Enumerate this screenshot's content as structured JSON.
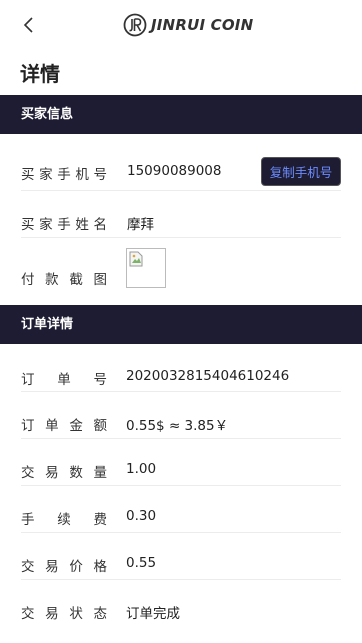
{
  "header": {
    "back_icon": "chevron-left-icon",
    "logo_text": "JINRUI COIN",
    "logo_icon": "jr-logo-icon"
  },
  "page_title": "详情",
  "buyer_section": {
    "title": "买家信息",
    "phone_label": [
      "买",
      "家",
      "手",
      "机",
      "号"
    ],
    "phone_value": "15090089008",
    "copy_button": "复制手机号",
    "name_label": [
      "买",
      "家",
      "手",
      "姓",
      "名"
    ],
    "name_value": "摩拜",
    "screenshot_label": [
      "付",
      "款",
      "截",
      "图"
    ],
    "screenshot_icon": "broken-image-icon"
  },
  "order_section": {
    "title": "订单详情",
    "rows": [
      {
        "label": [
          "订",
          "单",
          "号"
        ],
        "value": "2020032815404610246"
      },
      {
        "label": [
          "订",
          "单",
          "金",
          "额"
        ],
        "value": "0.55$ ≈ 3.85￥"
      },
      {
        "label": [
          "交",
          "易",
          "数",
          "量"
        ],
        "value": "1.00"
      },
      {
        "label": [
          "手",
          "续",
          "费"
        ],
        "value": "0.30"
      },
      {
        "label": [
          "交",
          "易",
          "价",
          "格"
        ],
        "value": "0.55"
      },
      {
        "label": [
          "交",
          "易",
          "状",
          "态"
        ],
        "value": "订单完成"
      }
    ]
  },
  "colors": {
    "section_bg": "#1e1c33",
    "button_text": "#6d8dff"
  }
}
